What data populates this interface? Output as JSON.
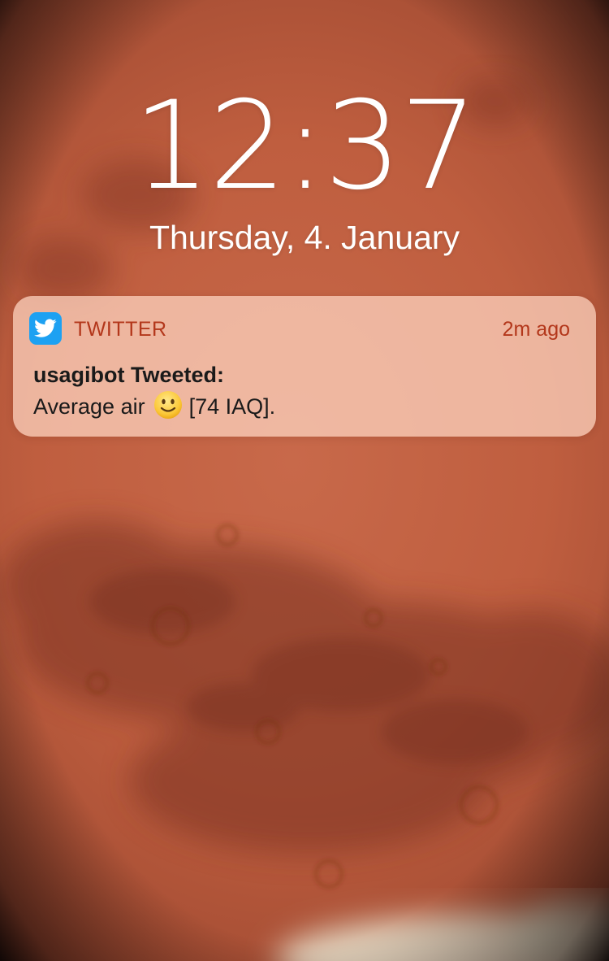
{
  "lockscreen": {
    "time": "12:37",
    "date": "Thursday, 4. January"
  },
  "notification": {
    "app_name": "TWITTER",
    "app_icon": "twitter-bird-icon",
    "timestamp": "2m ago",
    "title": "usagibot Tweeted:",
    "body_before_emoji": "Average air",
    "emoji": "slightly-smiling-face-emoji",
    "body_after_emoji": "[74 IAQ]."
  },
  "wallpaper": {
    "subject": "mars-planet",
    "colors": {
      "base": "#c8694a",
      "dark_terrain": "#8f3d27",
      "edge": "#1d0f0b",
      "polar_cap": "#e9e4cf"
    }
  },
  "colors": {
    "accent": "#b3371b",
    "twitter_blue": "#1da1f2",
    "notification_bg": "rgba(255, 215, 195, 0.72)",
    "text": "#1a1a1a"
  }
}
